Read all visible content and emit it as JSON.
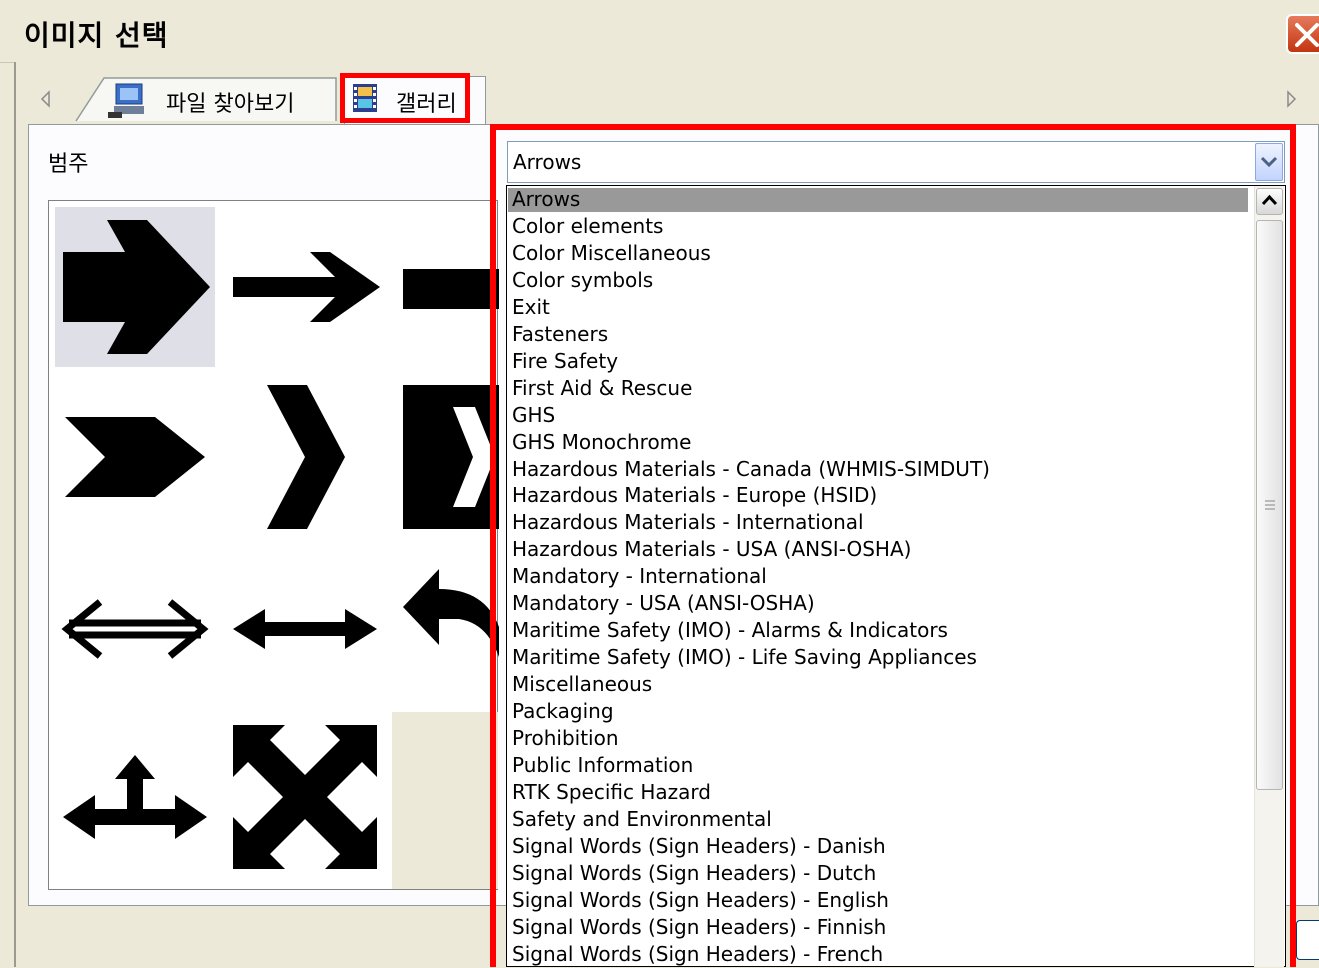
{
  "window": {
    "title": "이미지 선택"
  },
  "tabs": [
    {
      "label": "파일 찾아보기",
      "active": false
    },
    {
      "label": "갤러리",
      "active": true
    }
  ],
  "category": {
    "label": "범주",
    "selected_value": "Arrows",
    "options": [
      "Arrows",
      "Color elements",
      "Color Miscellaneous",
      "Color symbols",
      "Exit",
      "Fasteners",
      "Fire Safety",
      "First Aid & Rescue",
      "GHS",
      "GHS Monochrome",
      "Hazardous Materials - Canada (WHMIS-SIMDUT)",
      "Hazardous Materials - Europe (HSID)",
      "Hazardous Materials - International",
      "Hazardous Materials - USA (ANSI-OSHA)",
      "Mandatory - International",
      "Mandatory - USA (ANSI-OSHA)",
      "Maritime Safety (IMO) - Alarms & Indicators",
      "Maritime Safety (IMO) - Life Saving Appliances",
      "Miscellaneous",
      "Packaging",
      "Prohibition",
      "Public Information",
      "RTK Specific Hazard",
      "Safety and Environmental",
      "Signal Words (Sign Headers) - Danish",
      "Signal Words (Sign Headers) - Dutch",
      "Signal Words (Sign Headers) - English",
      "Signal Words (Sign Headers) - Finnish",
      "Signal Words (Sign Headers) - French"
    ]
  },
  "gallery_icons": [
    "arrow-right-bold-icon",
    "arrow-right-thin-icon",
    "arrow-right-block-icon",
    "chevron-arrow-icon",
    "chevron-thin-icon",
    "chevron-box-icon",
    "double-arrow-outline-icon",
    "double-arrow-icon",
    "curved-arrow-icon",
    "tee-arrow-icon",
    "four-way-arrow-icon"
  ],
  "colors": {
    "highlight": "#ff0000",
    "selected_option_bg": "#999999",
    "close_button": "#d9482b"
  }
}
